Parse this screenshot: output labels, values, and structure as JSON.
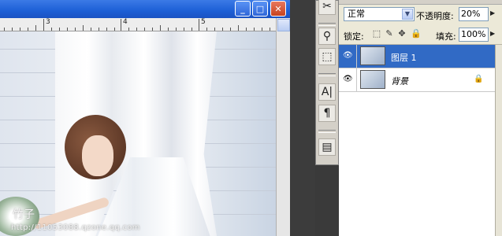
{
  "window": {
    "minimize_glyph": "_",
    "maximize_glyph": "□",
    "close_glyph": "✕"
  },
  "ruler": {
    "numbers": [
      "3",
      "4",
      "5"
    ]
  },
  "photo": {
    "watermark_name": "竹子",
    "watermark_url": "http://11053088.qzone.qq.com"
  },
  "tools": {
    "icons": [
      "brush-tool-icon",
      "clone-stamp-icon",
      "history-brush-icon",
      "character-panel-icon",
      "paragraph-panel-icon",
      "layer-comps-icon"
    ],
    "glyphs": [
      "✂",
      "⚲",
      "⬚",
      "A|",
      "¶",
      "▤"
    ]
  },
  "layers": {
    "blend_mode": "正常",
    "opacity_label": "不透明度:",
    "opacity_value": "20%",
    "lock_label": "锁定:",
    "fill_label": "填充:",
    "fill_value": "100%",
    "items": [
      {
        "name": "图层 1",
        "selected": true,
        "visible": true
      },
      {
        "name": "背景",
        "selected": false,
        "visible": true,
        "locked": true
      }
    ]
  },
  "colors": {
    "selection": "#316ac5",
    "titlebar": "#1d5fd6",
    "panel_bg": "#ece9d8"
  }
}
